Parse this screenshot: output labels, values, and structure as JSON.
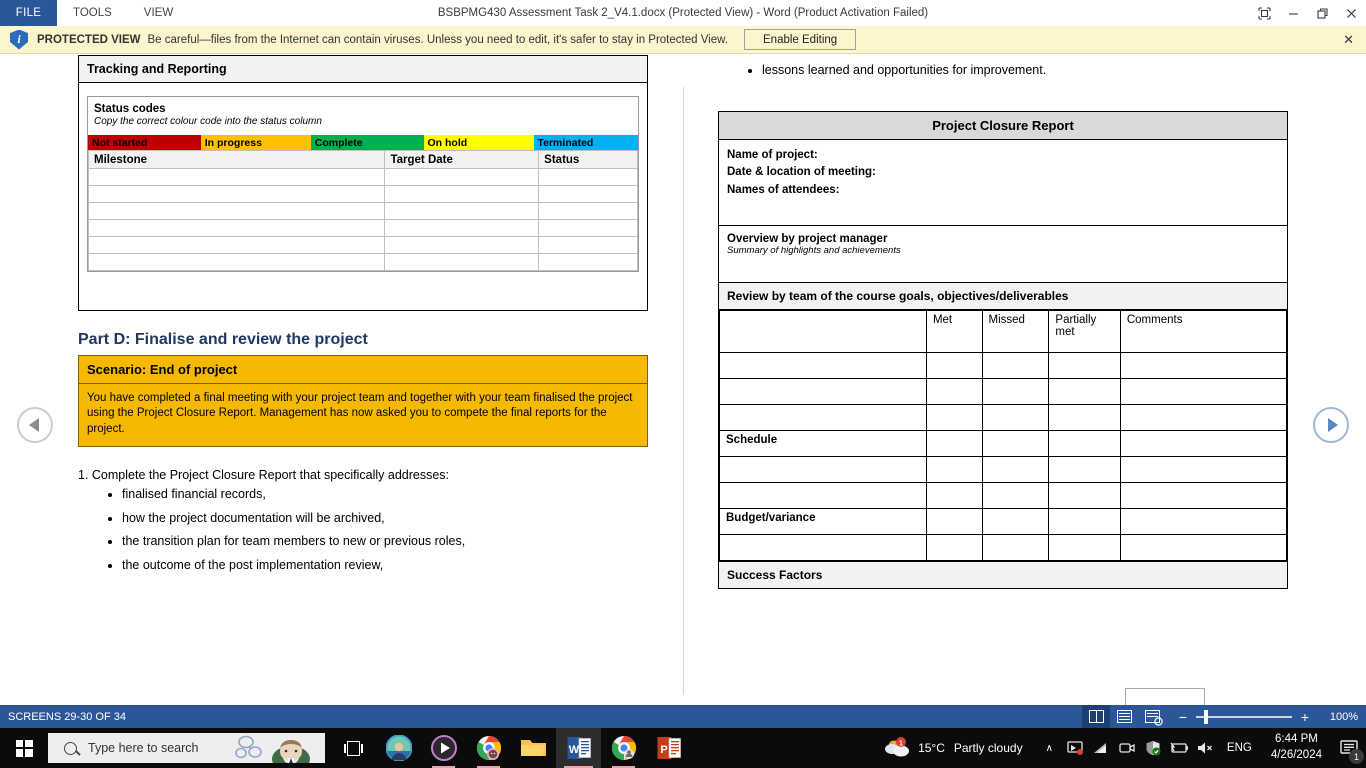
{
  "titlebar": {
    "tabs": [
      {
        "label": "FILE",
        "active": true
      },
      {
        "label": "TOOLS",
        "active": false
      },
      {
        "label": "VIEW",
        "active": false
      }
    ],
    "document_title": "BSBPMG430 Assessment Task 2_V4.1.docx (Protected View) - Word (Product Activation Failed)",
    "window_buttons": {
      "ribbon_display": "❐",
      "minimize": "─",
      "restore": "❐",
      "close": "✕"
    }
  },
  "protected_view": {
    "shield_letter": "i",
    "label": "PROTECTED VIEW",
    "message": "Be careful—files from the Internet can contain viruses. Unless you need to edit, it's safer to stay in Protected View.",
    "enable_button": "Enable Editing",
    "close": "✕"
  },
  "navigation": {
    "prev_label": "◀",
    "next_label": "▶"
  },
  "left_page": {
    "tracking": {
      "header": "Tracking and Reporting",
      "status_codes": {
        "title": "Status codes",
        "subtitle": "Copy the correct colour code into the status column",
        "codes": [
          {
            "label": "Not started",
            "color": "#C00000",
            "width": "20.5%"
          },
          {
            "label": "In progress",
            "color": "#FFC000",
            "width": "20%"
          },
          {
            "label": "Complete",
            "color": "#00B050",
            "width": "20.5%"
          },
          {
            "label": "On hold",
            "color": "#FFFF00",
            "width": "20%"
          },
          {
            "label": "Terminated",
            "color": "#00B0F0",
            "width": "19%"
          }
        ]
      },
      "milestone_table": {
        "columns": [
          "Milestone",
          "Target Date",
          "Status"
        ],
        "rows": [
          [
            "",
            "",
            ""
          ],
          [
            "",
            "",
            ""
          ],
          [
            "",
            "",
            ""
          ],
          [
            "",
            "",
            ""
          ],
          [
            "",
            "",
            ""
          ],
          [
            "",
            "",
            ""
          ]
        ]
      }
    },
    "part_d": {
      "title": "Part D: Finalise and review the project",
      "scenario_header": "Scenario: End of project",
      "scenario_body": "You have completed a final meeting with your project team and together with your team finalised the project using the Project Closure Report. Management has now asked you to compete the final reports for the project.",
      "question": "1. Complete the Project Closure Report that specifically addresses:",
      "bullets": [
        "finalised financial records,",
        "how the project documentation will be archived,",
        "the transition plan for team members to new or previous roles,",
        "the outcome of the post implementation review,"
      ]
    }
  },
  "right_page": {
    "continued_bullets": [
      "lessons learned and opportunities for improvement."
    ],
    "closure_report": {
      "title": "Project Closure Report",
      "identification": [
        "Name of project:",
        "Date & location of meeting:",
        "Names of attendees:"
      ],
      "overview_title": "Overview by project manager",
      "overview_subtitle": "Summary of highlights and achievements",
      "review_section": "Review by team of the course goals, objectives/deliverables",
      "review_columns": [
        "",
        "Met",
        "Missed",
        "Partially met",
        "Comments"
      ],
      "review_rows": [
        [
          "",
          "",
          "",
          "",
          ""
        ],
        [
          "",
          "",
          "",
          "",
          ""
        ],
        [
          "",
          "",
          "",
          "",
          ""
        ],
        [
          "Schedule",
          "",
          "",
          "",
          ""
        ],
        [
          "",
          "",
          "",
          "",
          ""
        ],
        [
          "",
          "",
          "",
          "",
          ""
        ],
        [
          "Budget/variance",
          "",
          "",
          "",
          ""
        ],
        [
          "",
          "",
          "",
          "",
          ""
        ]
      ],
      "success_factors": "Success Factors"
    }
  },
  "statusbar": {
    "screens": "SCREENS 29-30 OF 34",
    "views": [
      "read-mode-icon",
      "print-layout-icon",
      "web-layout-icon"
    ],
    "zoom_out": "−",
    "zoom_in": "+",
    "zoom_level": "100%"
  },
  "taskbar": {
    "start": "windows-logo-icon",
    "search_placeholder": "Type here to search",
    "task_view": "task-view-icon",
    "apps": [
      {
        "name": "photos-app-icon"
      },
      {
        "name": "media-player-icon"
      },
      {
        "name": "chrome-profile-icon"
      },
      {
        "name": "file-explorer-icon"
      },
      {
        "name": "word-icon",
        "active": true
      },
      {
        "name": "chrome-icon"
      },
      {
        "name": "powerpoint-icon"
      }
    ],
    "tray": {
      "weather_temp": "15°C",
      "weather_desc": "Partly cloudy",
      "chevron": "∧",
      "icons": [
        "screen-cast-icon",
        "wifi-icon",
        "camera-icon",
        "security-icon",
        "battery-icon",
        "volume-muted-icon"
      ],
      "language": "ENG",
      "time": "6:44 PM",
      "date": "4/26/2024",
      "notification_count": "1"
    }
  }
}
